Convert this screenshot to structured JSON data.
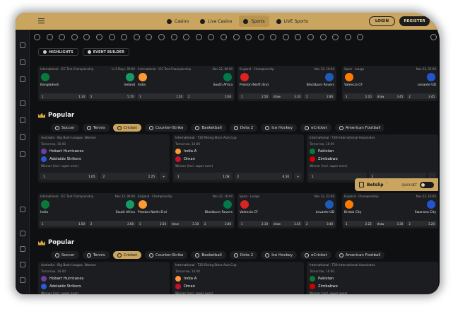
{
  "nav": {
    "casino": "Casino",
    "live_casino": "Live Casino",
    "sports": "Sports",
    "live_sports": "LIVE Sports"
  },
  "auth": {
    "login": "LOGIN",
    "register": "REGISTER"
  },
  "tabs": {
    "highlights": "HIGHLIGHTS",
    "event_builder": "EVENT BUILDER"
  },
  "top_matches": [
    {
      "league": "International · ICC Test Championship",
      "date": "In 2 Days, 09:00",
      "home": "Bangladesh",
      "away": "Ireland",
      "o1": "1",
      "v1": "1.14",
      "o2": "2",
      "v2": "5.70"
    },
    {
      "league": "International · ICC Test Championship",
      "date": "Nov 22, 06:00",
      "home": "India",
      "away": "South Africa",
      "o1": "1",
      "v1": "1.50",
      "o2": "2",
      "v2": "2.60"
    },
    {
      "league": "England · Championship",
      "date": "Nov 22, 16:00",
      "home": "Preston North End",
      "away": "Blackburn Rovers",
      "o1": "1",
      "v1": "2.50",
      "ox": "draw",
      "vx": "3.10",
      "o2": "2",
      "v2": "2.80"
    },
    {
      "league": "Spain · LaLiga",
      "date": "Nov 22, 22:00",
      "home": "Valencia CF",
      "away": "Levante UD",
      "o1": "1",
      "v1": "2.10",
      "ox": "draw",
      "vx": "3.45",
      "o2": "2",
      "v2": "3.45"
    }
  ],
  "popular": {
    "title": "Popular",
    "sports": [
      "Soccer",
      "Tennis",
      "Cricket",
      "Counter-Strike",
      "Basketball",
      "Dota 2",
      "Ice Hockey",
      "eCricket",
      "American Football"
    ]
  },
  "popular_matches": [
    {
      "league": "Australia · Big Bash League, Women",
      "time_label": "Tomorrow,",
      "time": "16:00",
      "home": "Hobart Hurricanes",
      "away": "Adelaide Strikers",
      "market": "Winner (incl. super over)",
      "o1": "1",
      "v1": "1.65",
      "o2": "2",
      "v2": "2.25",
      "more": "+"
    },
    {
      "league": "International · T20 Rising Stars Asia Cup",
      "time_label": "Tomorrow,",
      "time": "16:00",
      "home": "India A",
      "away": "Oman",
      "market": "Winner (incl. super over)",
      "o1": "1",
      "v1": "1.08",
      "o2": "2",
      "v2": "6.50",
      "more": "+"
    },
    {
      "league": "International · T20 International Associates",
      "time_label": "Tomorrow,",
      "time": "16:00",
      "home": "Pakistan",
      "away": "Zimbabwe",
      "market": "Winner (incl. super over)",
      "o1": "1",
      "v1": "",
      "o2": "2",
      "v2": "",
      "more": ""
    }
  ],
  "top_matches_2": [
    {
      "league": "International · ICC Test Championship",
      "date": "Nov 22, 06:00",
      "home": "India",
      "away": "South Africa",
      "o1": "1",
      "v1": "1.50",
      "o2": "2",
      "v2": "2.60"
    },
    {
      "league": "England · Championship",
      "date": "Nov 22, 16:00",
      "home": "Preston North End",
      "away": "Blackburn Rovers",
      "o1": "1",
      "v1": "2.50",
      "ox": "draw",
      "vx": "3.10",
      "o2": "2",
      "v2": "2.80"
    },
    {
      "league": "Spain · LaLiga",
      "date": "Nov 22, 22:00",
      "home": "Valencia CF",
      "away": "Levante UD",
      "o1": "1",
      "v1": "2.10",
      "ox": "draw",
      "vx": "3.45",
      "o2": "2",
      "v2": "3.40"
    },
    {
      "league": "England · Championship",
      "date": "Nov 22, 16:00",
      "home": "Bristol City",
      "away": "Swansea City",
      "o1": "1",
      "v1": "2.22",
      "ox": "draw",
      "vx": "3.30",
      "o2": "2",
      "v2": "3.20"
    }
  ],
  "betslip": {
    "label": "Betslip",
    "quick_bet": "QUICK BET"
  },
  "colors": {
    "gold": "#c9a560",
    "bg": "#0f1012",
    "card": "#1b1d20"
  }
}
